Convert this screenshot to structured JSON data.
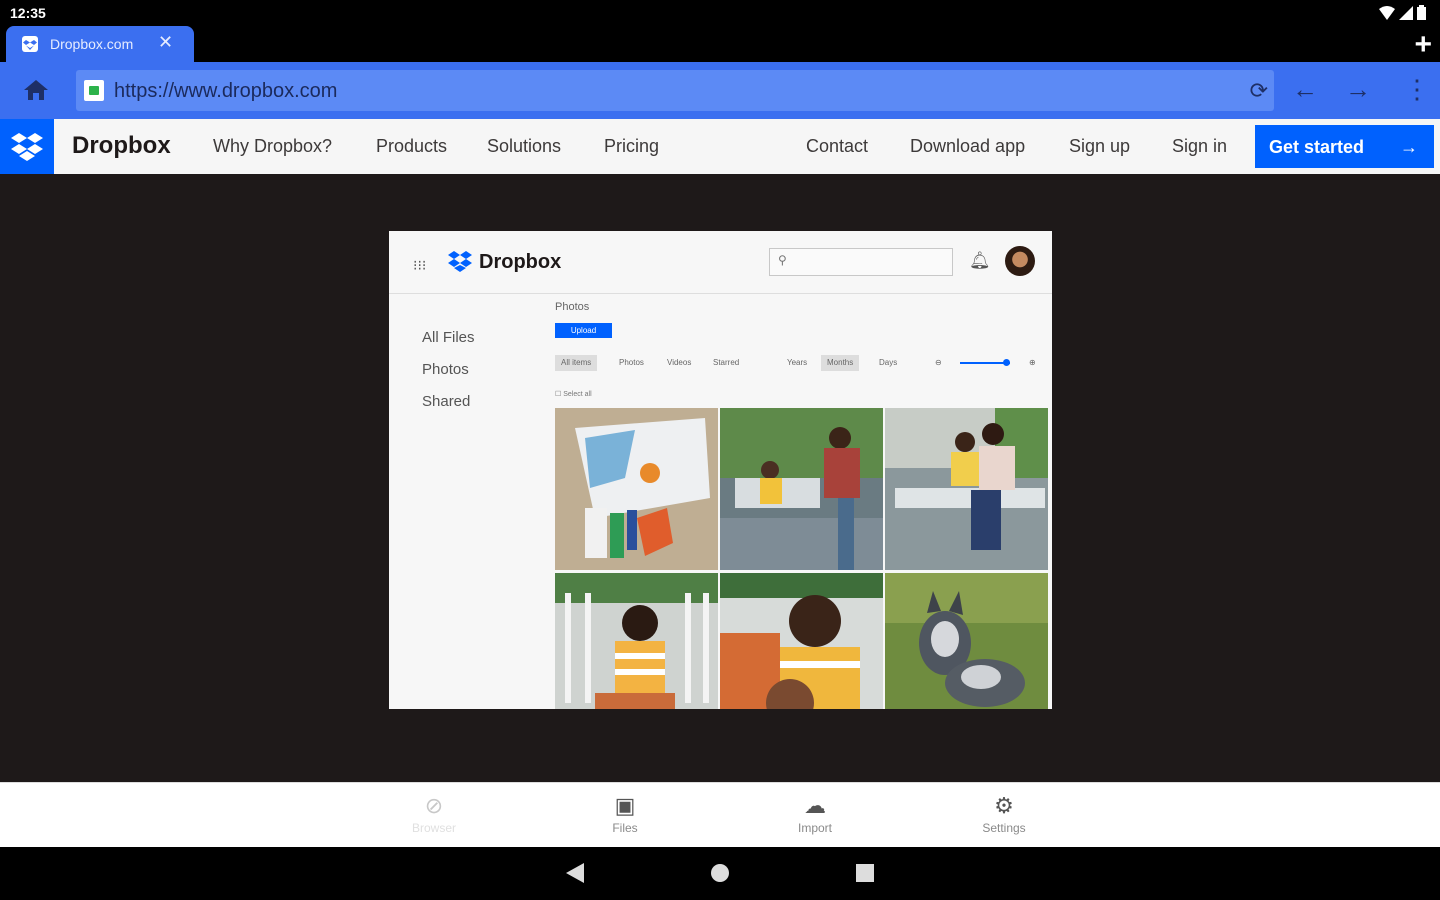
{
  "status_bar": {
    "time": "12:35"
  },
  "browser": {
    "tab_title": "Dropbox.com",
    "url": "https://www.dropbox.com"
  },
  "site_header": {
    "brand": "Dropbox",
    "nav": [
      "Why Dropbox?",
      "Products",
      "Solutions",
      "Pricing"
    ],
    "right_nav": [
      "Contact",
      "Download app",
      "Sign up",
      "Sign in"
    ],
    "cta": "Get started",
    "brand_color": "#0061fe"
  },
  "preview": {
    "brand": "Dropbox",
    "sidebar": [
      "All Files",
      "Photos",
      "Shared"
    ],
    "breadcrumb": "Photos",
    "upload_label": "Upload",
    "filters": [
      "All items",
      "Photos",
      "Videos",
      "Starred"
    ],
    "time_filters": [
      "Years",
      "Months",
      "Days"
    ],
    "select_all": "Select all"
  },
  "app_nav": {
    "items": [
      {
        "label": "Browser",
        "icon": "compass-icon"
      },
      {
        "label": "Files",
        "icon": "files-icon"
      },
      {
        "label": "Import",
        "icon": "cloud-icon"
      },
      {
        "label": "Settings",
        "icon": "gears-icon"
      }
    ]
  },
  "colors": {
    "browser_blue": "#3b6ff0",
    "stage_bg": "#1e1919"
  }
}
